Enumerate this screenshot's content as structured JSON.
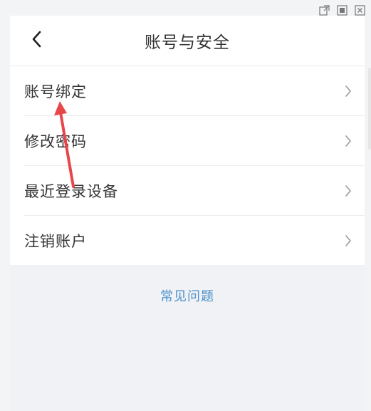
{
  "window_controls": {
    "icons": [
      "popout-icon",
      "maximize-icon",
      "close-icon"
    ]
  },
  "header": {
    "back_icon": "chevron-left-icon",
    "title": "账号与安全"
  },
  "menu": {
    "items": [
      {
        "label": "账号绑定",
        "icon": "chevron-right-icon"
      },
      {
        "label": "修改密码",
        "icon": "chevron-right-icon"
      },
      {
        "label": "最近登录设备",
        "icon": "chevron-right-icon"
      },
      {
        "label": "注销账户",
        "icon": "chevron-right-icon"
      }
    ]
  },
  "footer": {
    "faq_label": "常见问题"
  },
  "colors": {
    "background": "#f1f2f5",
    "card": "#ffffff",
    "text": "#333333",
    "link": "#4a90c8",
    "annotation": "#e8474a"
  }
}
